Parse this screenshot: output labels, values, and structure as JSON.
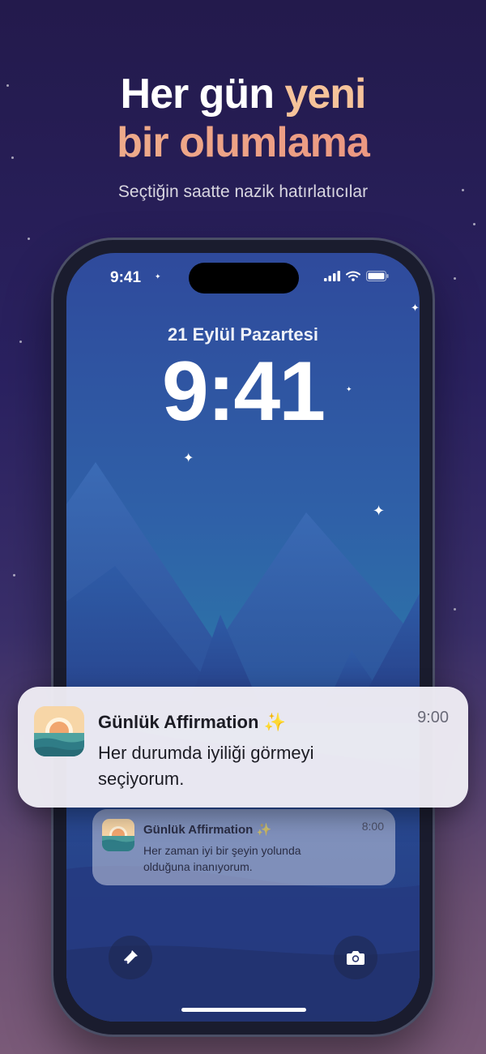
{
  "headline": {
    "line1_part1": "Her gün ",
    "line1_accent": "yeni",
    "line2": "bir olumlama",
    "subtitle": "Seçtiğin saatte nazik hatırlatıcılar"
  },
  "status_bar": {
    "time": "9:41"
  },
  "lockscreen": {
    "date": "21 Eylül Pazartesi",
    "time": "9:41"
  },
  "notifications": [
    {
      "app": "Günlük Affirmation",
      "emoji": "✨",
      "time": "9:00",
      "body_line1": "Her durumda iyiliği görmeyi",
      "body_line2": "seçiyorum."
    },
    {
      "app": "Günlük Affirmation",
      "emoji": "✨",
      "time": "8:00",
      "body_line1": "Her zaman iyi bir şeyin yolunda",
      "body_line2": "olduğuna inanıyorum."
    }
  ],
  "colors": {
    "accent_peach": "#f6c39a",
    "accent_coral": "#ea8f7d",
    "background": "#2a2160"
  },
  "icons": [
    "sparkle-icon",
    "flashlight-icon",
    "camera-icon",
    "signal-icon",
    "wifi-icon",
    "battery-icon",
    "sunset-app-icon"
  ]
}
